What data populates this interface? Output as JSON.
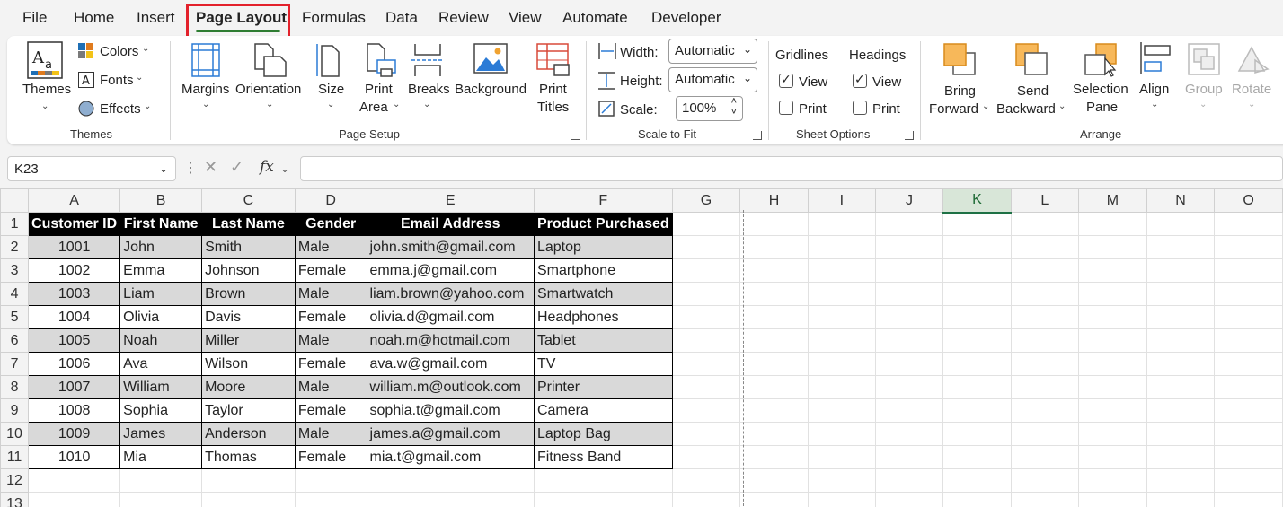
{
  "menu": {
    "tabs": [
      "File",
      "Home",
      "Insert",
      "Page Layout",
      "Formulas",
      "Data",
      "Review",
      "View",
      "Automate",
      "Developer"
    ],
    "active_tab": "Page Layout"
  },
  "ribbon": {
    "themes": {
      "themes_label": "Themes",
      "colors_label": "Colors",
      "fonts_label": "Fonts",
      "effects_label": "Effects",
      "group_label": "Themes"
    },
    "page_setup": {
      "margins": "Margins",
      "orientation": "Orientation",
      "size": "Size",
      "print_area_1": "Print",
      "print_area_2": "Area",
      "breaks": "Breaks",
      "background": "Background",
      "print_titles_1": "Print",
      "print_titles_2": "Titles",
      "group_label": "Page Setup"
    },
    "scale_to_fit": {
      "width_label": "Width:",
      "width_value": "Automatic",
      "height_label": "Height:",
      "height_value": "Automatic",
      "scale_label": "Scale:",
      "scale_value": "100%",
      "group_label": "Scale to Fit"
    },
    "sheet_options": {
      "gridlines": "Gridlines",
      "headings": "Headings",
      "view": "View",
      "print": "Print",
      "gridlines_view_checked": true,
      "gridlines_print_checked": false,
      "headings_view_checked": true,
      "headings_print_checked": false,
      "group_label": "Sheet Options"
    },
    "arrange": {
      "bring_forward_1": "Bring",
      "bring_forward_2": "Forward",
      "send_backward_1": "Send",
      "send_backward_2": "Backward",
      "selection_pane_1": "Selection",
      "selection_pane_2": "Pane",
      "align": "Align",
      "group": "Group",
      "rotate": "Rotate",
      "group_label": "Arrange"
    }
  },
  "formula_bar": {
    "name_box": "K23",
    "fx": "fx",
    "content": ""
  },
  "sheet": {
    "columns": [
      "A",
      "B",
      "C",
      "D",
      "E",
      "F",
      "G",
      "H",
      "I",
      "J",
      "K",
      "L",
      "M",
      "N",
      "O"
    ],
    "selected_column": "K",
    "row_numbers": [
      "1",
      "2",
      "3",
      "4",
      "5",
      "6",
      "7",
      "8",
      "9",
      "10",
      "11",
      "12",
      "13"
    ],
    "headers": [
      "Customer ID",
      "First Name",
      "Last Name",
      "Gender",
      "Email Address",
      "Product Purchased"
    ],
    "rows": [
      [
        "1001",
        "John",
        "Smith",
        "Male",
        "john.smith@gmail.com",
        "Laptop"
      ],
      [
        "1002",
        "Emma",
        "Johnson",
        "Female",
        "emma.j@gmail.com",
        "Smartphone"
      ],
      [
        "1003",
        "Liam",
        "Brown",
        "Male",
        "liam.brown@yahoo.com",
        "Smartwatch"
      ],
      [
        "1004",
        "Olivia",
        "Davis",
        "Female",
        "olivia.d@gmail.com",
        "Headphones"
      ],
      [
        "1005",
        "Noah",
        "Miller",
        "Male",
        "noah.m@hotmail.com",
        "Tablet"
      ],
      [
        "1006",
        "Ava",
        "Wilson",
        "Female",
        "ava.w@gmail.com",
        "TV"
      ],
      [
        "1007",
        "William",
        "Moore",
        "Male",
        "william.m@outlook.com",
        "Printer"
      ],
      [
        "1008",
        "Sophia",
        "Taylor",
        "Female",
        "sophia.t@gmail.com",
        "Camera"
      ],
      [
        "1009",
        "James",
        "Anderson",
        "Male",
        "james.a@gmail.com",
        "Laptop Bag"
      ],
      [
        "1010",
        "Mia",
        "Thomas",
        "Female",
        "mia.t@gmail.com",
        "Fitness Band"
      ]
    ]
  },
  "colors": {
    "accent_green": "#1e7145",
    "highlight_red": "#e3212b",
    "header_fill": "#000000",
    "band_fill": "#d9d9d9"
  }
}
